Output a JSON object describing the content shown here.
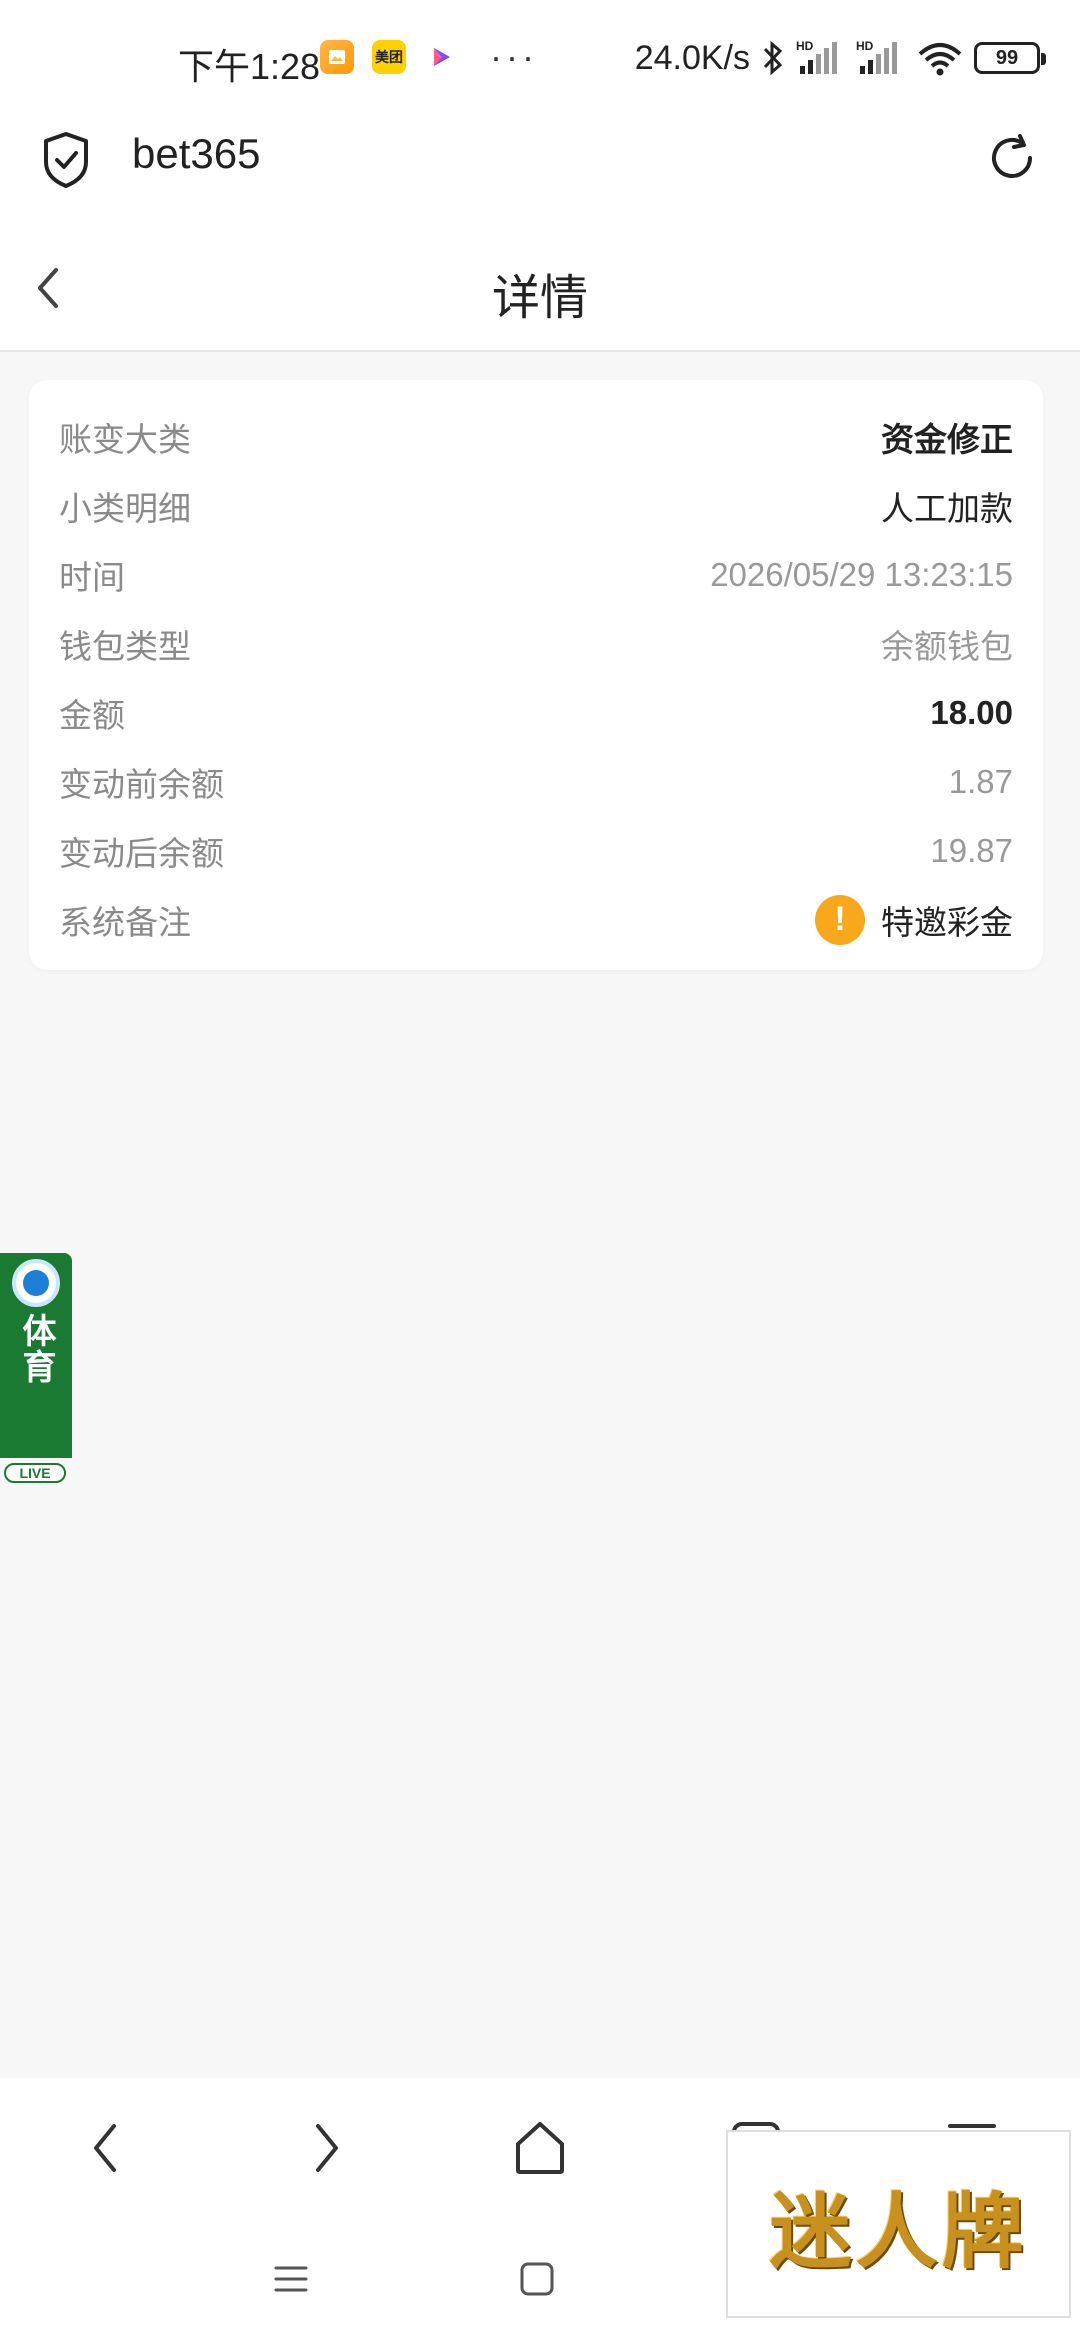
{
  "status_bar": {
    "time": "下午1:28",
    "app_meituan": "美团",
    "more": "···",
    "net_speed": "24.0K/s",
    "battery": "99"
  },
  "browser": {
    "site_name": "bet365"
  },
  "page": {
    "title": "详情"
  },
  "detail": {
    "rows": [
      {
        "label": "账变大类",
        "value": "资金修正"
      },
      {
        "label": "小类明细",
        "value": "人工加款"
      },
      {
        "label": "时间",
        "value": "2026/05/29 13:23:15"
      },
      {
        "label": "钱包类型",
        "value": "余额钱包"
      },
      {
        "label": "金额",
        "value": "18.00"
      },
      {
        "label": "变动前余额",
        "value": "1.87"
      },
      {
        "label": "变动后余额",
        "value": "19.87"
      },
      {
        "label": "系统备注",
        "value": "特邀彩金"
      }
    ],
    "alert_glyph": "!"
  },
  "live_badge": {
    "text": "体育",
    "label": "LIVE"
  },
  "watermark": {
    "text": "迷人牌"
  },
  "colors": {
    "accent_orange": "#f7a81b",
    "live_green": "#1a7a32",
    "background": "#f7f7f7"
  }
}
